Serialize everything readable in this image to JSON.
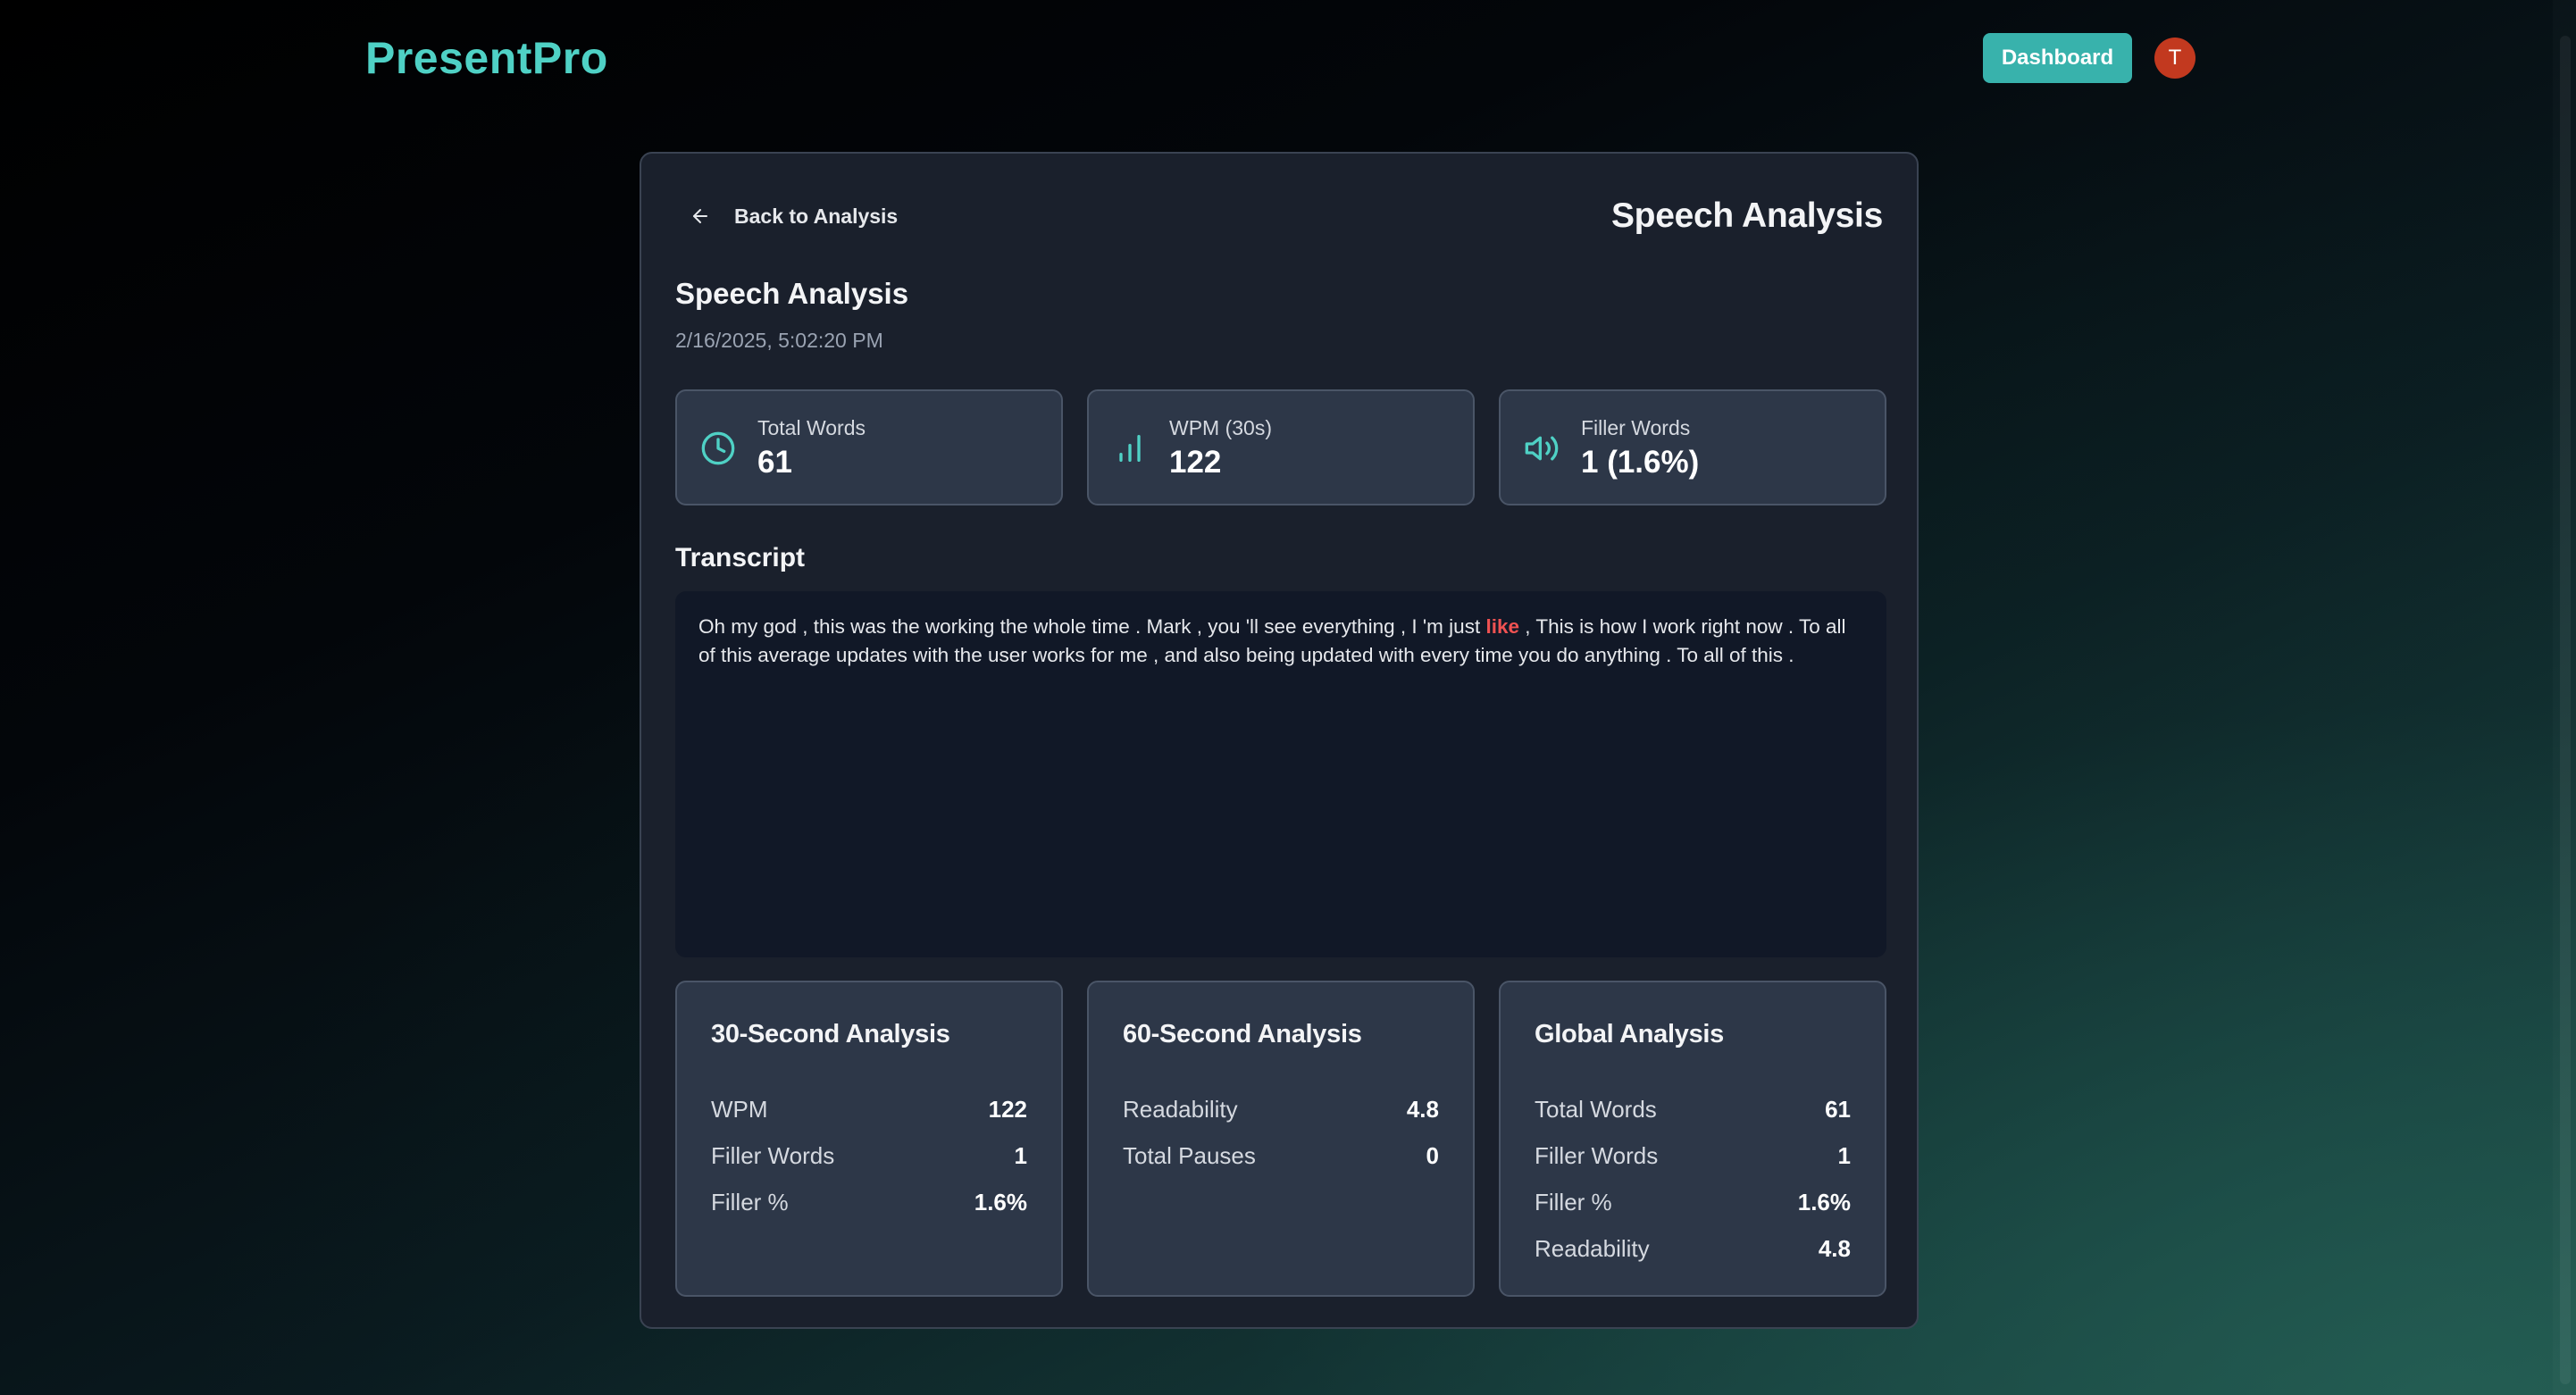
{
  "header": {
    "logo": "PresentPro",
    "dashboard_label": "Dashboard",
    "avatar_initial": "T"
  },
  "card": {
    "back_label": "Back to Analysis",
    "title_right": "Speech Analysis",
    "section_title": "Speech Analysis",
    "timestamp": "2/16/2025, 5:02:20 PM"
  },
  "stats": [
    {
      "label": "Total Words",
      "value": "61",
      "icon": "clock-icon"
    },
    {
      "label": "WPM (30s)",
      "value": "122",
      "icon": "bar-chart-icon"
    },
    {
      "label": "Filler Words",
      "value": "1 (1.6%)",
      "icon": "speaker-icon"
    }
  ],
  "transcript": {
    "title": "Transcript",
    "before": "Oh my god , this was the working the whole time . Mark , you 'll see everything , I 'm just ",
    "filler": "like",
    "after": " , This is how I work right now . To all of this average updates with the user works for me , and also being updated with every time you do anything . To all of this ."
  },
  "analysis": [
    {
      "title": "30-Second Analysis",
      "rows": [
        {
          "label": "WPM",
          "value": "122"
        },
        {
          "label": "Filler Words",
          "value": "1"
        },
        {
          "label": "Filler %",
          "value": "1.6%"
        }
      ]
    },
    {
      "title": "60-Second Analysis",
      "rows": [
        {
          "label": "Readability",
          "value": "4.8"
        },
        {
          "label": "Total Pauses",
          "value": "0"
        }
      ]
    },
    {
      "title": "Global Analysis",
      "rows": [
        {
          "label": "Total Words",
          "value": "61"
        },
        {
          "label": "Filler Words",
          "value": "1"
        },
        {
          "label": "Filler %",
          "value": "1.6%"
        },
        {
          "label": "Readability",
          "value": "4.8"
        }
      ]
    }
  ],
  "colors": {
    "accent": "#4fd1c5",
    "button": "#38b2ac",
    "avatar": "#c2391f",
    "filler_highlight": "#f05252",
    "card_bg": "#1a202c",
    "panel_bg": "#2d3748",
    "transcript_bg": "#111827"
  }
}
